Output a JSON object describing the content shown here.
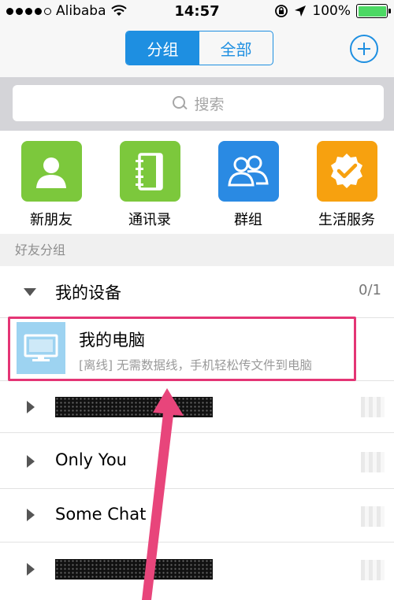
{
  "status_bar": {
    "carrier": "Alibaba",
    "time": "14:57",
    "battery": "100%"
  },
  "nav": {
    "segments": [
      "分组",
      "全部"
    ],
    "active_segment": "分组"
  },
  "search": {
    "placeholder": "搜索"
  },
  "quick_functions": [
    {
      "label": "新朋友",
      "icon": "person-icon",
      "color": "#7cc83c"
    },
    {
      "label": "通讯录",
      "icon": "address-book-icon",
      "color": "#7cc83c"
    },
    {
      "label": "群组",
      "icon": "group-icon",
      "color": "#2a8ae3"
    },
    {
      "label": "生活服务",
      "icon": "service-badge-icon",
      "color": "#f7a10f"
    }
  ],
  "section_header": "好友分组",
  "groups": [
    {
      "name": "我的设备",
      "count": "0/1",
      "expanded": true
    },
    {
      "name": "",
      "redacted": true
    },
    {
      "name": "Only You"
    },
    {
      "name": "Some Chat"
    },
    {
      "name": "",
      "redacted": true
    }
  ],
  "device": {
    "name": "我的电脑",
    "description": "[离线] 无需数据线，手机轻松传文件到电脑",
    "icon": "monitor-icon"
  },
  "colors": {
    "accent": "#1e8fe1",
    "highlight": "#e43575"
  }
}
